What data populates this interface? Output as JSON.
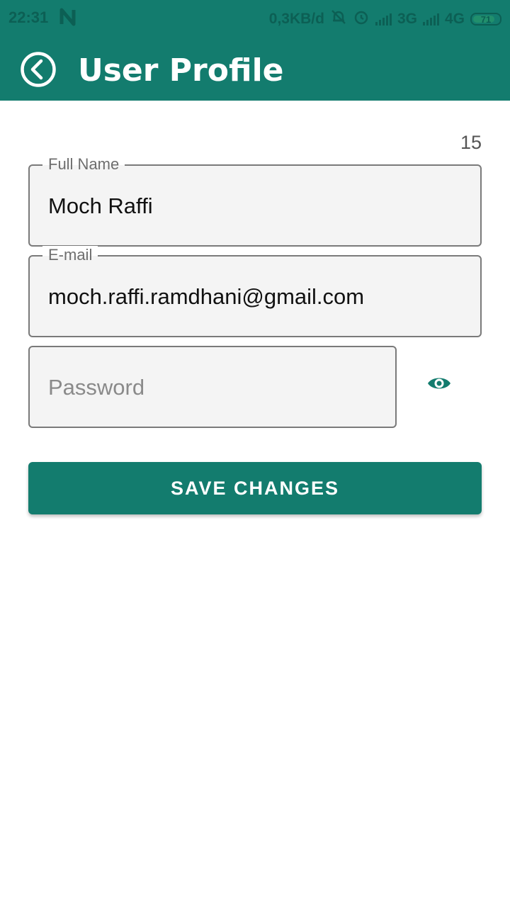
{
  "status_bar": {
    "time": "22:31",
    "network_speed": "0,3KB/d",
    "signal_1": "3G",
    "signal_2": "4G",
    "battery": "71",
    "icons": [
      "n-notification-icon",
      "bell-muted-icon",
      "alarm-icon",
      "signal-icon",
      "battery-icon"
    ]
  },
  "header": {
    "title": "User Profile",
    "back_icon": "back-arrow-circle-icon",
    "background_color": "#137C6E"
  },
  "form": {
    "counter": "15",
    "full_name": {
      "label": "Full Name",
      "value": "Moch Raffi"
    },
    "email": {
      "label": "E-mail",
      "value": "moch.raffi.ramdhani@gmail.com"
    },
    "password": {
      "placeholder": "Password",
      "toggle_icon": "eye-icon"
    },
    "save_label": "SAVE CHANGES"
  }
}
